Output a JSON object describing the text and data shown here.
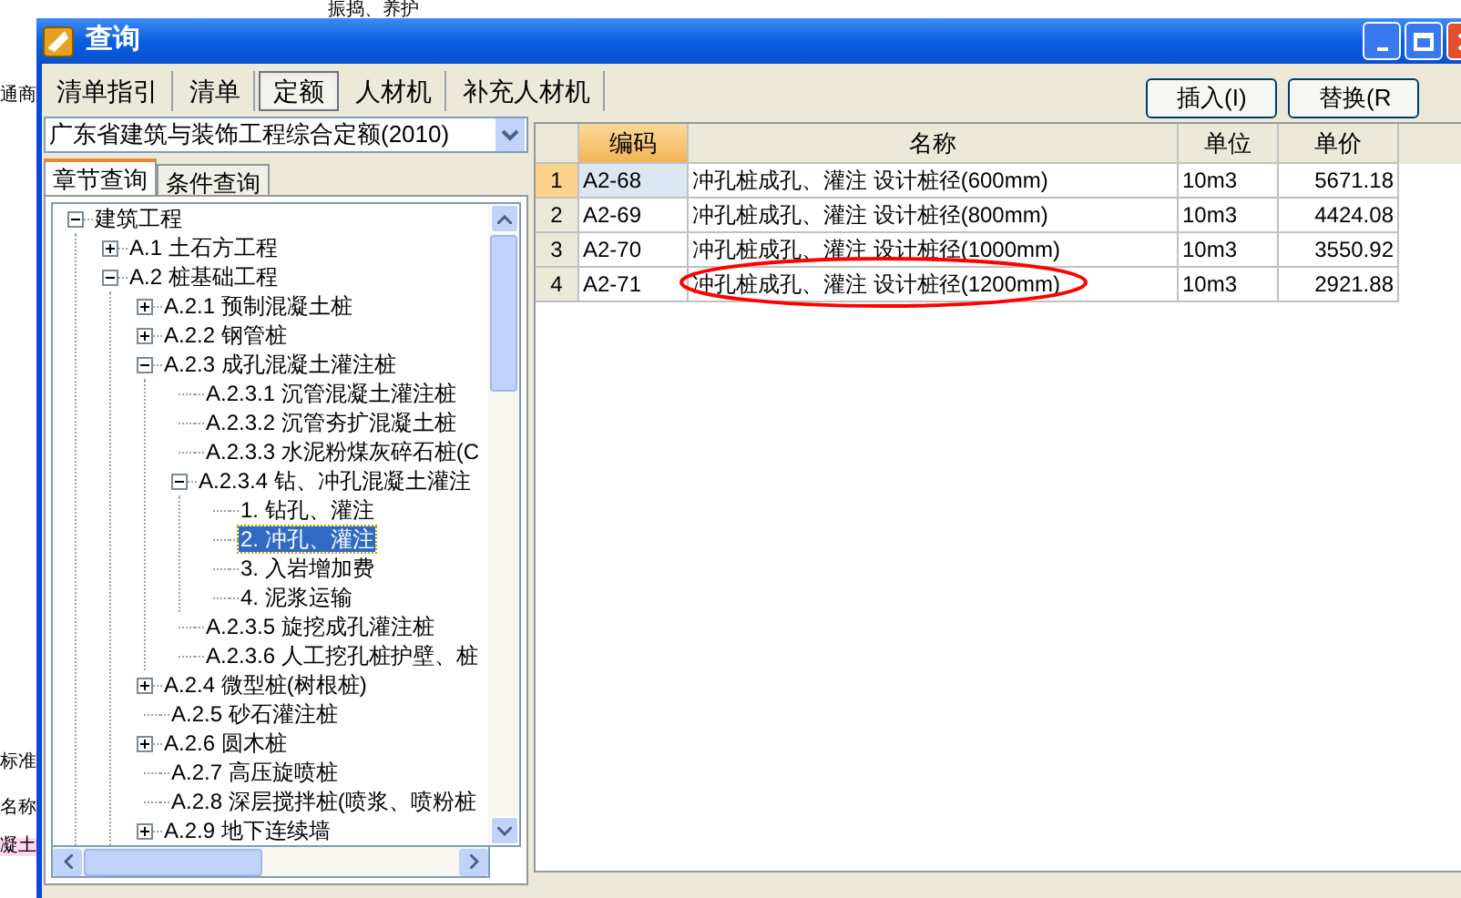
{
  "background": {
    "texts": [
      "振捣、养护",
      "通商",
      "标准",
      "名称",
      "凝土"
    ]
  },
  "window": {
    "title": "查询"
  },
  "tabs": [
    {
      "label": "清单指引",
      "selected": false
    },
    {
      "label": "清单",
      "selected": false
    },
    {
      "label": "定额",
      "selected": true
    },
    {
      "label": "人材机",
      "selected": false
    },
    {
      "label": "补充人材机",
      "selected": false
    }
  ],
  "quota_select": {
    "value": "广东省建筑与装饰工程综合定额(2010)"
  },
  "subtabs": [
    {
      "label": "章节查询",
      "selected": true
    },
    {
      "label": "条件查询",
      "selected": false
    }
  ],
  "tree": [
    {
      "label": "建筑工程",
      "expanded": true,
      "selected": false,
      "children": [
        {
          "label": "A.1 土石方工程",
          "expanded": false,
          "selected": false
        },
        {
          "label": "A.2 桩基础工程",
          "expanded": true,
          "selected": false,
          "children": [
            {
              "label": "A.2.1 预制混凝土桩",
              "expanded": false,
              "selected": false
            },
            {
              "label": "A.2.2 钢管桩",
              "expanded": false,
              "selected": false
            },
            {
              "label": "A.2.3 成孔混凝土灌注桩",
              "expanded": true,
              "selected": false,
              "children": [
                {
                  "label": "A.2.3.1 沉管混凝土灌注桩",
                  "selected": false
                },
                {
                  "label": "A.2.3.2 沉管夯扩混凝土桩",
                  "selected": false
                },
                {
                  "label": "A.2.3.3 水泥粉煤灰碎石桩(C",
                  "selected": false
                },
                {
                  "label": "A.2.3.4 钻、冲孔混凝土灌注",
                  "expanded": true,
                  "selected": false,
                  "children": [
                    {
                      "label": "1. 钻孔、灌注",
                      "selected": false
                    },
                    {
                      "label": "2. 冲孔、灌注",
                      "selected": true
                    },
                    {
                      "label": "3. 入岩增加费",
                      "selected": false
                    },
                    {
                      "label": "4. 泥浆运输",
                      "selected": false
                    }
                  ]
                },
                {
                  "label": "A.2.3.5 旋挖成孔灌注桩",
                  "selected": false
                },
                {
                  "label": "A.2.3.6 人工挖孔桩护壁、桩",
                  "selected": false
                }
              ]
            },
            {
              "label": "A.2.4 微型桩(树根桩)",
              "expanded": false,
              "selected": false
            },
            {
              "label": "A.2.5 砂石灌注桩",
              "selected": false
            },
            {
              "label": "A.2.6 圆木桩",
              "expanded": false,
              "selected": false
            },
            {
              "label": "A.2.7 高压旋喷桩",
              "selected": false
            },
            {
              "label": "A.2.8 深层搅拌桩(喷浆、喷粉桩",
              "selected": false
            },
            {
              "label": "A.2.9 地下连续墙",
              "expanded": false,
              "selected": false
            }
          ]
        }
      ]
    }
  ],
  "buttons": [
    "插入(I)",
    "替换(R"
  ],
  "table": {
    "columns": [
      "编码",
      "名称",
      "单位",
      "单价"
    ],
    "rows": [
      {
        "number": "1",
        "code": "A2-68",
        "name": "冲孔桩成孔、灌注 设计桩径(600mm)",
        "unit": "10m3",
        "price": "5671.18",
        "selected": true,
        "circled": false
      },
      {
        "number": "2",
        "code": "A2-69",
        "name": "冲孔桩成孔、灌注 设计桩径(800mm)",
        "unit": "10m3",
        "price": "4424.08",
        "selected": false,
        "circled": false
      },
      {
        "number": "3",
        "code": "A2-70",
        "name": "冲孔桩成孔、灌注 设计桩径(1000mm)",
        "unit": "10m3",
        "price": "3550.92",
        "selected": false,
        "circled": false
      },
      {
        "number": "4",
        "code": "A2-71",
        "name": "冲孔桩成孔、灌注 设计桩径(1200mm)",
        "unit": "10m3",
        "price": "2921.88",
        "selected": false,
        "circled": true
      }
    ]
  }
}
